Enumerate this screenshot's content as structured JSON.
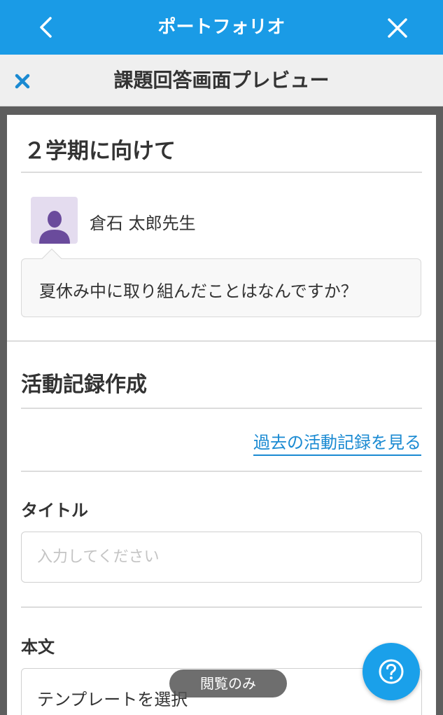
{
  "header": {
    "title": "ポートフォリオ",
    "back_icon": "chevron-left-icon",
    "close_icon": "close-icon"
  },
  "subheader": {
    "title": "課題回答画面プレビュー",
    "close_icon": "close-icon",
    "close_color": "#1a8ad2"
  },
  "assignment": {
    "title": "２学期に向けて",
    "teacher_name": "倉石 太郎先生",
    "question": "夏休み中に取り組んだことはなんですか？"
  },
  "activity": {
    "section_title": "活動記録作成",
    "past_records_link": "過去の活動記録を見る",
    "title_label": "タイトル",
    "title_placeholder": "入力してください",
    "body_label": "本文",
    "template_select": "テンプレートを選択"
  },
  "mode_badge": "閲覧のみ",
  "help_icon": "question-circle-icon",
  "colors": {
    "primary": "#1a9be6",
    "link": "#1a8ad2",
    "avatar_bg": "#e4dcef",
    "avatar_fg": "#6a4b9c"
  }
}
